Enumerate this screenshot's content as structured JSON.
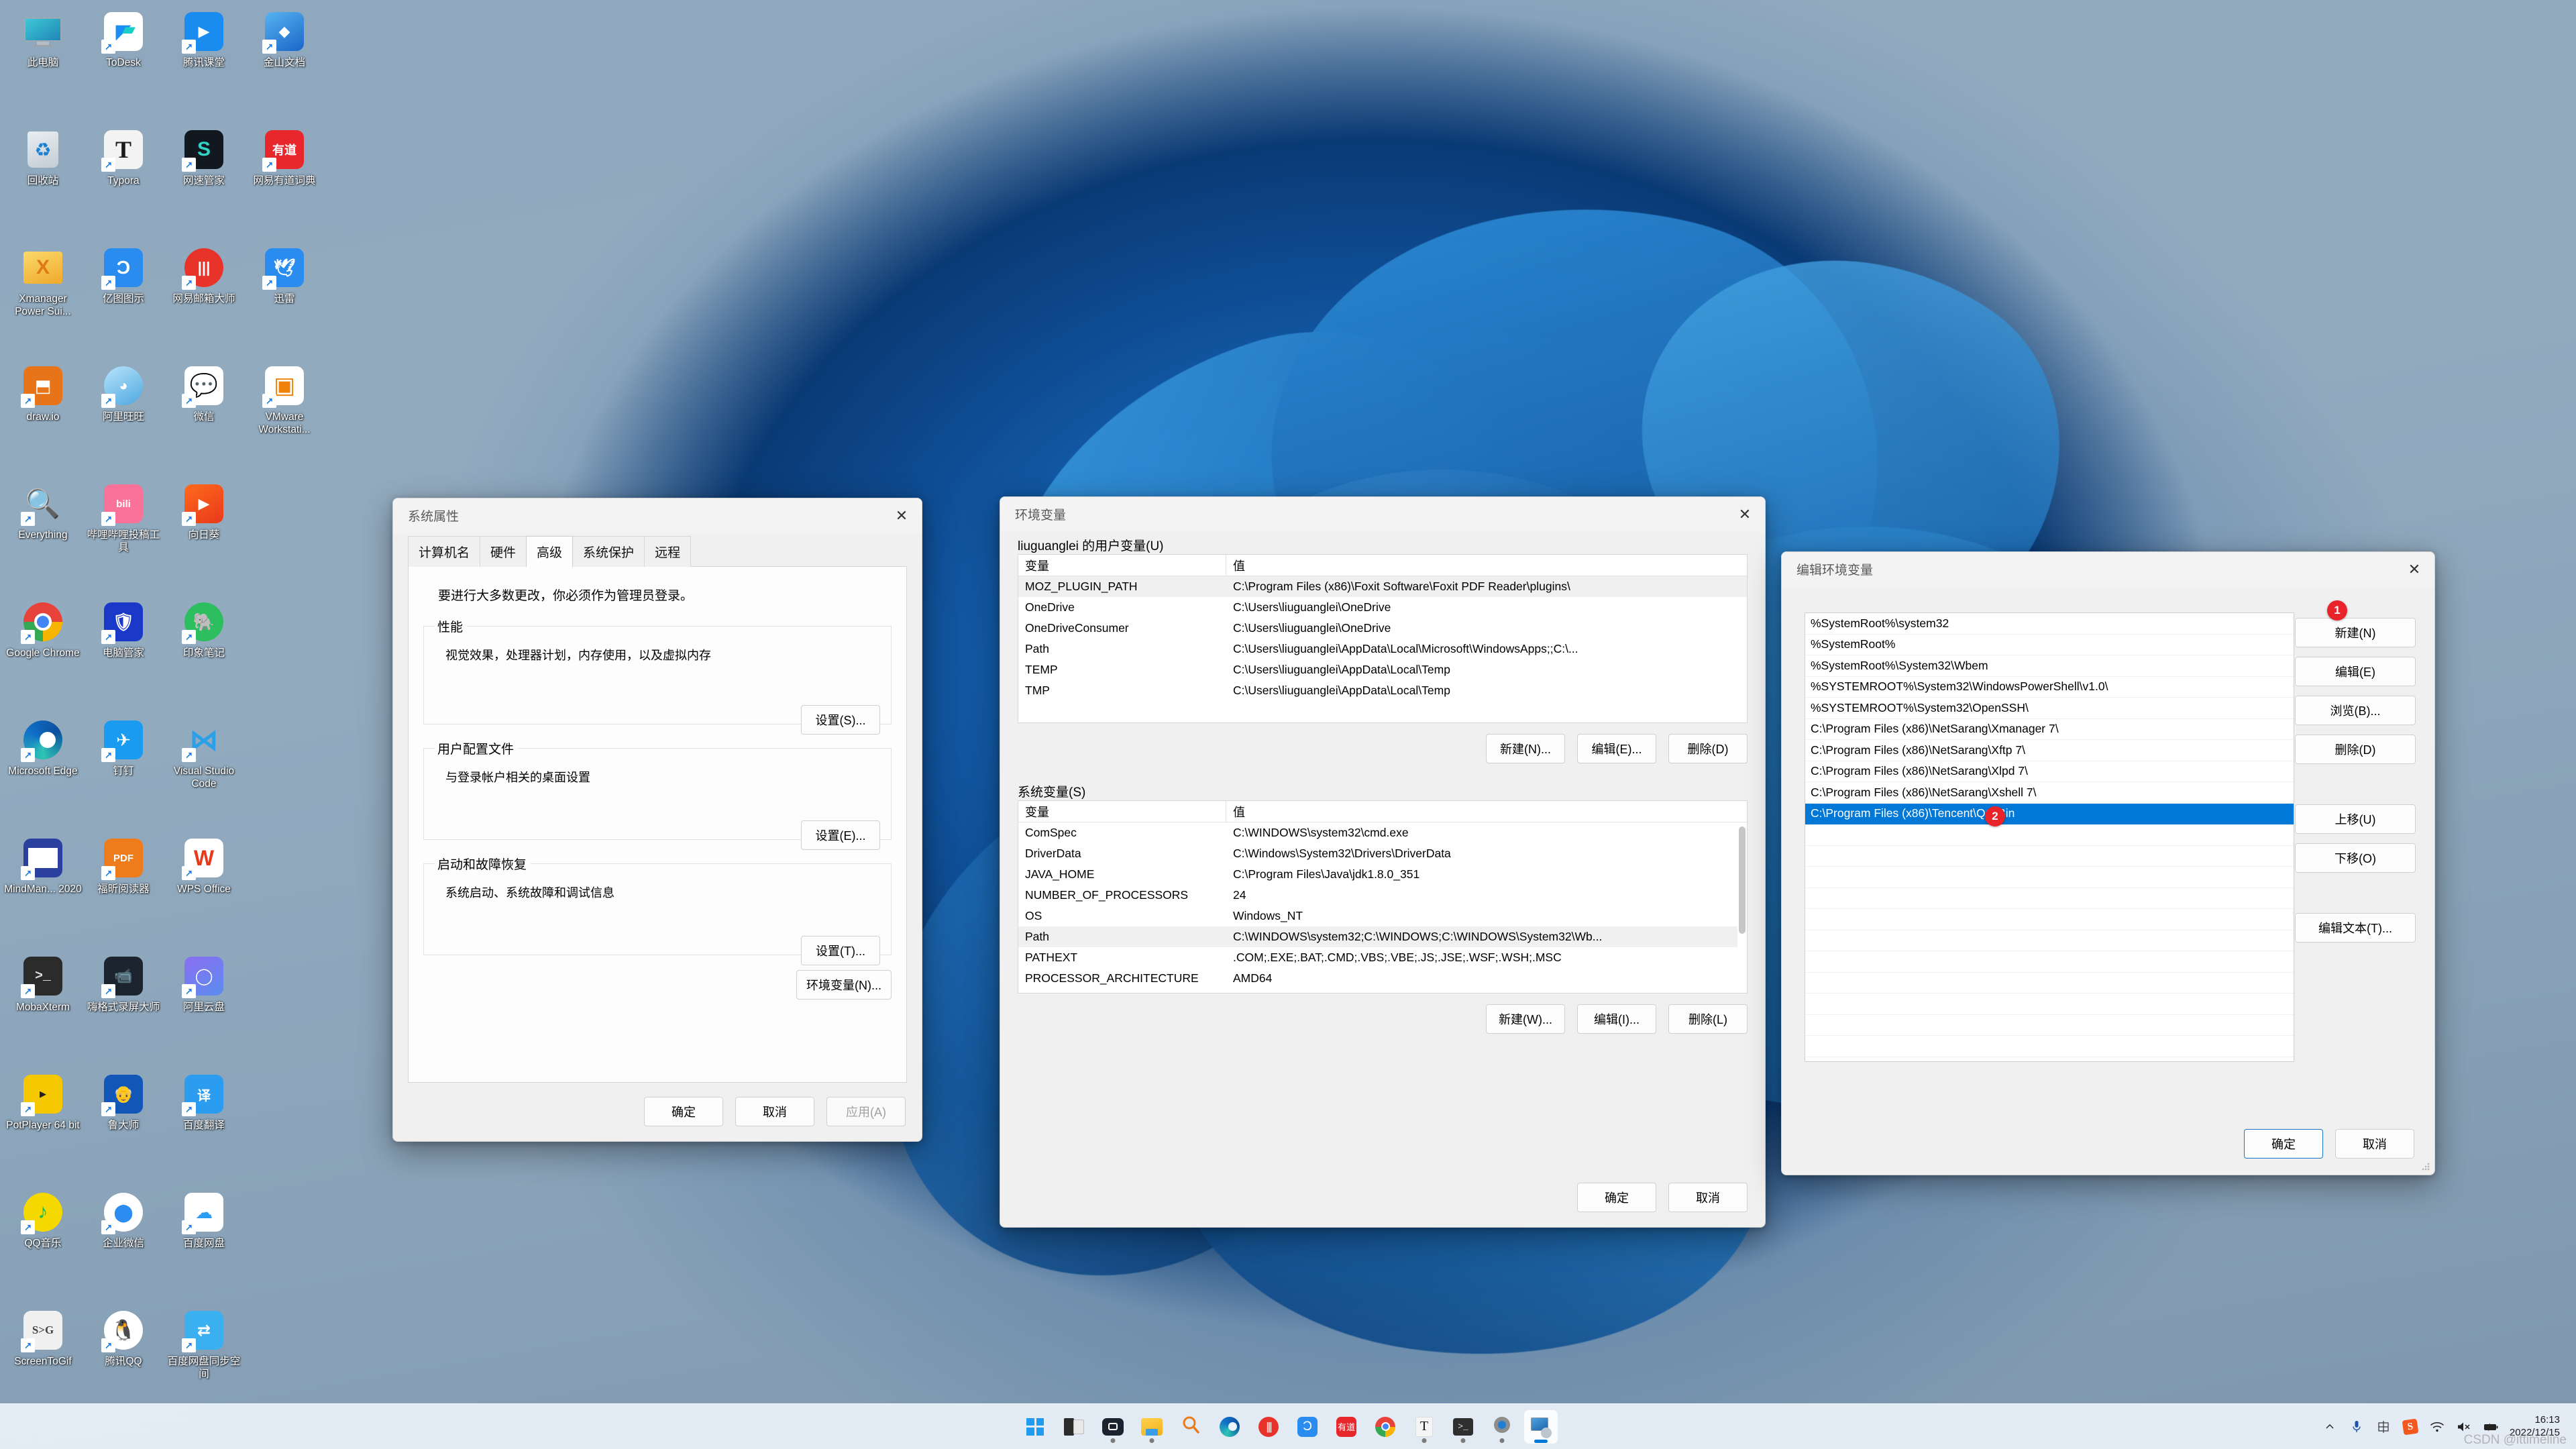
{
  "desktop": {
    "icons": [
      {
        "label": "此电脑",
        "icon": "this-pc-icon",
        "shortcut": false
      },
      {
        "label": "ToDesk",
        "icon": "todesk-icon",
        "shortcut": true
      },
      {
        "label": "腾讯课堂",
        "icon": "tencent-classroom-icon",
        "shortcut": true
      },
      {
        "label": "金山文档",
        "icon": "kingsoft-docs-icon",
        "shortcut": true
      },
      {
        "label": "回收站",
        "icon": "recycle-bin-icon",
        "shortcut": false
      },
      {
        "label": "Typora",
        "icon": "typora-icon",
        "shortcut": true
      },
      {
        "label": "网速管家",
        "icon": "netspeed-manager-icon",
        "shortcut": true
      },
      {
        "label": "网易有道词典",
        "icon": "youdao-dict-icon",
        "shortcut": true
      },
      {
        "label": "Xmanager Power Sui...",
        "icon": "xmanager-icon",
        "shortcut": false
      },
      {
        "label": "亿图图示",
        "icon": "edraw-icon",
        "shortcut": true
      },
      {
        "label": "网易邮箱大师",
        "icon": "netease-mail-icon",
        "shortcut": true
      },
      {
        "label": "迅雷",
        "icon": "thunder-icon",
        "shortcut": true
      },
      {
        "label": "draw.io",
        "icon": "drawio-icon",
        "shortcut": true
      },
      {
        "label": "阿里旺旺",
        "icon": "aliwangwang-icon",
        "shortcut": true
      },
      {
        "label": "微信",
        "icon": "wechat-icon",
        "shortcut": true
      },
      {
        "label": "VMware Workstati...",
        "icon": "vmware-icon",
        "shortcut": true
      },
      {
        "label": "Everything",
        "icon": "everything-icon",
        "shortcut": true
      },
      {
        "label": "哔哩哔哩投稿工具",
        "icon": "bilibili-upload-icon",
        "shortcut": true
      },
      {
        "label": "向日葵",
        "icon": "sunflower-icon",
        "shortcut": true
      },
      {
        "label": "",
        "icon": "blank-icon",
        "shortcut": false
      },
      {
        "label": "Google Chrome",
        "icon": "chrome-icon",
        "shortcut": true
      },
      {
        "label": "电脑管家",
        "icon": "pc-manager-icon",
        "shortcut": true
      },
      {
        "label": "印象笔记",
        "icon": "evernote-icon",
        "shortcut": true
      },
      {
        "label": "",
        "icon": "blank-icon",
        "shortcut": false
      },
      {
        "label": "Microsoft Edge",
        "icon": "edge-icon",
        "shortcut": true
      },
      {
        "label": "钉钉",
        "icon": "dingtalk-icon",
        "shortcut": true
      },
      {
        "label": "Visual Studio Code",
        "icon": "vscode-icon",
        "shortcut": true
      },
      {
        "label": "",
        "icon": "blank-icon",
        "shortcut": false
      },
      {
        "label": "MindMan... 2020",
        "icon": "mindmanager-icon",
        "shortcut": true
      },
      {
        "label": "福昕阅读器",
        "icon": "foxit-reader-icon",
        "shortcut": true
      },
      {
        "label": "WPS Office",
        "icon": "wps-office-icon",
        "shortcut": true
      },
      {
        "label": "",
        "icon": "blank-icon",
        "shortcut": false
      },
      {
        "label": "MobaXterm",
        "icon": "mobaxterm-icon",
        "shortcut": true
      },
      {
        "label": "嗨格式录屏大师",
        "icon": "higeshi-recorder-icon",
        "shortcut": true
      },
      {
        "label": "阿里云盘",
        "icon": "aliyun-drive-icon",
        "shortcut": true
      },
      {
        "label": "",
        "icon": "blank-icon",
        "shortcut": false
      },
      {
        "label": "PotPlayer 64 bit",
        "icon": "potplayer-icon",
        "shortcut": true
      },
      {
        "label": "鲁大师",
        "icon": "ludashi-icon",
        "shortcut": true
      },
      {
        "label": "百度翻译",
        "icon": "baidu-translate-icon",
        "shortcut": true
      },
      {
        "label": "",
        "icon": "blank-icon",
        "shortcut": false
      },
      {
        "label": "QQ音乐",
        "icon": "qq-music-icon",
        "shortcut": true
      },
      {
        "label": "企业微信",
        "icon": "wecom-icon",
        "shortcut": true
      },
      {
        "label": "百度网盘",
        "icon": "baidu-netdisk-icon",
        "shortcut": true
      },
      {
        "label": "",
        "icon": "blank-icon",
        "shortcut": false
      },
      {
        "label": "ScreenToGif",
        "icon": "screentogif-icon",
        "shortcut": true
      },
      {
        "label": "腾讯QQ",
        "icon": "tencent-qq-icon",
        "shortcut": true
      },
      {
        "label": "百度网盘同步空间",
        "icon": "baidu-netdisk-sync-icon",
        "shortcut": true
      },
      {
        "label": "",
        "icon": "blank-icon",
        "shortcut": false
      }
    ]
  },
  "system_properties": {
    "title": "系统属性",
    "close_label": "✕",
    "tabs": [
      {
        "label": "计算机名",
        "active": false
      },
      {
        "label": "硬件",
        "active": false
      },
      {
        "label": "高级",
        "active": true
      },
      {
        "label": "系统保护",
        "active": false
      },
      {
        "label": "远程",
        "active": false
      }
    ],
    "hint": "要进行大多数更改，你必须作为管理员登录。",
    "groups": [
      {
        "legend": "性能",
        "desc": "视觉效果，处理器计划，内存使用，以及虚拟内存",
        "button": "设置(S)..."
      },
      {
        "legend": "用户配置文件",
        "desc": "与登录帐户相关的桌面设置",
        "button": "设置(E)..."
      },
      {
        "legend": "启动和故障恢复",
        "desc": "系统启动、系统故障和调试信息",
        "button": "设置(T)..."
      }
    ],
    "env_button": "环境变量(N)...",
    "ok_label": "确定",
    "cancel_label": "取消",
    "apply_label": "应用(A)"
  },
  "environment_variables": {
    "title": "环境变量",
    "close_label": "✕",
    "user_section": {
      "legend": "liuguanglei 的用户变量(U)",
      "columns": [
        "变量",
        "值"
      ],
      "rows": [
        {
          "name": "MOZ_PLUGIN_PATH",
          "value": "C:\\Program Files (x86)\\Foxit Software\\Foxit PDF Reader\\plugins\\",
          "selected": true
        },
        {
          "name": "OneDrive",
          "value": "C:\\Users\\liuguanglei\\OneDrive",
          "selected": false
        },
        {
          "name": "OneDriveConsumer",
          "value": "C:\\Users\\liuguanglei\\OneDrive",
          "selected": false
        },
        {
          "name": "Path",
          "value": "C:\\Users\\liuguanglei\\AppData\\Local\\Microsoft\\WindowsApps;;C:\\...",
          "selected": false
        },
        {
          "name": "TEMP",
          "value": "C:\\Users\\liuguanglei\\AppData\\Local\\Temp",
          "selected": false
        },
        {
          "name": "TMP",
          "value": "C:\\Users\\liuguanglei\\AppData\\Local\\Temp",
          "selected": false
        }
      ],
      "new_label": "新建(N)...",
      "edit_label": "编辑(E)...",
      "delete_label": "删除(D)"
    },
    "system_section": {
      "legend": "系统变量(S)",
      "columns": [
        "变量",
        "值"
      ],
      "rows": [
        {
          "name": "ComSpec",
          "value": "C:\\WINDOWS\\system32\\cmd.exe",
          "selected": false
        },
        {
          "name": "DriverData",
          "value": "C:\\Windows\\System32\\Drivers\\DriverData",
          "selected": false
        },
        {
          "name": "JAVA_HOME",
          "value": "C:\\Program Files\\Java\\jdk1.8.0_351",
          "selected": false
        },
        {
          "name": "NUMBER_OF_PROCESSORS",
          "value": "24",
          "selected": false
        },
        {
          "name": "OS",
          "value": "Windows_NT",
          "selected": false
        },
        {
          "name": "Path",
          "value": "C:\\WINDOWS\\system32;C:\\WINDOWS;C:\\WINDOWS\\System32\\Wb...",
          "selected": true
        },
        {
          "name": "PATHEXT",
          "value": ".COM;.EXE;.BAT;.CMD;.VBS;.VBE;.JS;.JSE;.WSF;.WSH;.MSC",
          "selected": false
        },
        {
          "name": "PROCESSOR_ARCHITECTURE",
          "value": "AMD64",
          "selected": false
        }
      ],
      "new_label": "新建(W)...",
      "edit_label": "编辑(I)...",
      "delete_label": "删除(L)"
    },
    "ok_label": "确定",
    "cancel_label": "取消"
  },
  "edit_environment_variable": {
    "title": "编辑环境变量",
    "close_label": "✕",
    "entries": [
      {
        "value": "%SystemRoot%\\system32",
        "selected": false
      },
      {
        "value": "%SystemRoot%",
        "selected": false
      },
      {
        "value": "%SystemRoot%\\System32\\Wbem",
        "selected": false
      },
      {
        "value": "%SYSTEMROOT%\\System32\\WindowsPowerShell\\v1.0\\",
        "selected": false
      },
      {
        "value": "%SYSTEMROOT%\\System32\\OpenSSH\\",
        "selected": false
      },
      {
        "value": "C:\\Program Files (x86)\\NetSarang\\Xmanager 7\\",
        "selected": false
      },
      {
        "value": "C:\\Program Files (x86)\\NetSarang\\Xftp 7\\",
        "selected": false
      },
      {
        "value": "C:\\Program Files (x86)\\NetSarang\\Xlpd 7\\",
        "selected": false
      },
      {
        "value": "C:\\Program Files (x86)\\NetSarang\\Xshell 7\\",
        "selected": false
      },
      {
        "value": "C:\\Program Files (x86)\\Tencent\\QQ\\Bin",
        "selected": true
      }
    ],
    "buttons": {
      "new_label": "新建(N)",
      "edit_label": "编辑(E)",
      "browse_label": "浏览(B)...",
      "delete_label": "删除(D)",
      "move_up_label": "上移(U)",
      "move_down_label": "下移(O)",
      "edit_text_label": "编辑文本(T)..."
    },
    "ok_label": "确定",
    "cancel_label": "取消",
    "annotations": [
      {
        "number": "1",
        "target": "new-button"
      },
      {
        "number": "2",
        "target": "selected-entry"
      }
    ]
  },
  "taskbar": {
    "items": [
      {
        "name": "start-button",
        "icon": "windows-logo-icon",
        "running": false,
        "active": false
      },
      {
        "name": "task-view-button",
        "icon": "task-view-icon",
        "running": false,
        "active": false
      },
      {
        "name": "meeting-app",
        "icon": "camera-meeting-icon",
        "running": true,
        "active": false
      },
      {
        "name": "file-explorer",
        "icon": "folder-icon",
        "running": true,
        "active": false
      },
      {
        "name": "everything-search",
        "icon": "magnifier-icon",
        "running": false,
        "active": false
      },
      {
        "name": "microsoft-edge",
        "icon": "edge-icon",
        "running": false,
        "active": false
      },
      {
        "name": "netease-mail",
        "icon": "netease-mail-icon",
        "running": false,
        "active": false
      },
      {
        "name": "edraw",
        "icon": "edraw-icon",
        "running": false,
        "active": false
      },
      {
        "name": "youdao-dict",
        "icon": "youdao-dict-icon",
        "running": false,
        "active": false
      },
      {
        "name": "google-chrome",
        "icon": "chrome-icon",
        "running": false,
        "active": false
      },
      {
        "name": "typora",
        "icon": "typora-icon",
        "running": true,
        "active": false
      },
      {
        "name": "terminal",
        "icon": "terminal-icon",
        "running": true,
        "active": false
      },
      {
        "name": "settings",
        "icon": "gear-icon",
        "running": true,
        "active": false
      },
      {
        "name": "system-properties",
        "icon": "system-properties-icon",
        "running": true,
        "active": true
      }
    ],
    "tray": [
      {
        "name": "show-hidden-icons",
        "icon": "chevron-up-icon"
      },
      {
        "name": "microphone",
        "icon": "microphone-icon"
      },
      {
        "name": "ime-chinese",
        "icon": "ime-chinese-icon"
      },
      {
        "name": "sogou-input",
        "icon": "sogou-icon"
      },
      {
        "name": "network",
        "icon": "wifi-icon"
      },
      {
        "name": "volume-muted",
        "icon": "speaker-muted-icon"
      },
      {
        "name": "battery-charging",
        "icon": "battery-charging-icon"
      }
    ],
    "clock": {
      "time": "16:13",
      "date": "2022/12/15"
    }
  },
  "watermark": "CSDN @ittimeline"
}
